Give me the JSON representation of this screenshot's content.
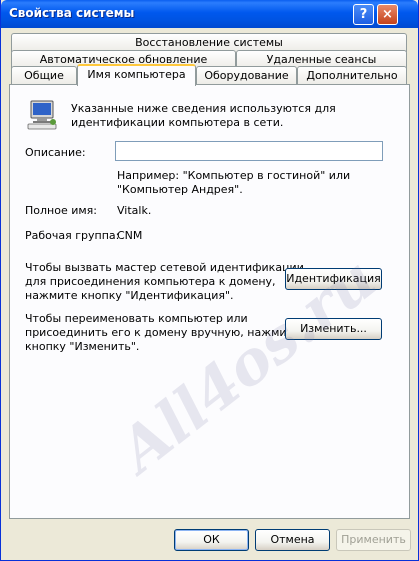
{
  "window": {
    "title": "Свойства системы",
    "help": "?",
    "close": "×"
  },
  "tabs": {
    "row1": [
      "Восстановление системы"
    ],
    "row2": [
      "Автоматическое обновление",
      "Удаленные сеансы"
    ],
    "row3": [
      "Общие",
      "Имя компьютера",
      "Оборудование",
      "Дополнительно"
    ]
  },
  "content": {
    "info_line1": "Указанные ниже сведения используются для",
    "info_line2": "идентификации компьютера в сети.",
    "description_label": "Описание:",
    "description_value": "",
    "example_line1": "Например: \"Компьютер в гостиной\" или",
    "example_line2": "\"Компьютер Андрея\".",
    "fullname_label": "Полное имя:",
    "fullname_value": "Vitalk.",
    "workgroup_label": "Рабочая группа:",
    "workgroup_value": "CNM",
    "wizard_text1": "Чтобы вызвать мастер сетевой идентификации",
    "wizard_text2": "для присоединения компьютера к домену,",
    "wizard_text3": "нажмите кнопку \"Идентификация\".",
    "ident_button": "Идентификация",
    "rename_text1": "Чтобы переименовать компьютер или",
    "rename_text2": "присоединить его к домену вручную, нажмите",
    "rename_text3": "кнопку \"Изменить\".",
    "change_button": "Изменить..."
  },
  "watermark": "All4os.ru",
  "footer": {
    "ok": "ОК",
    "cancel": "Отмена",
    "apply": "Применить"
  }
}
